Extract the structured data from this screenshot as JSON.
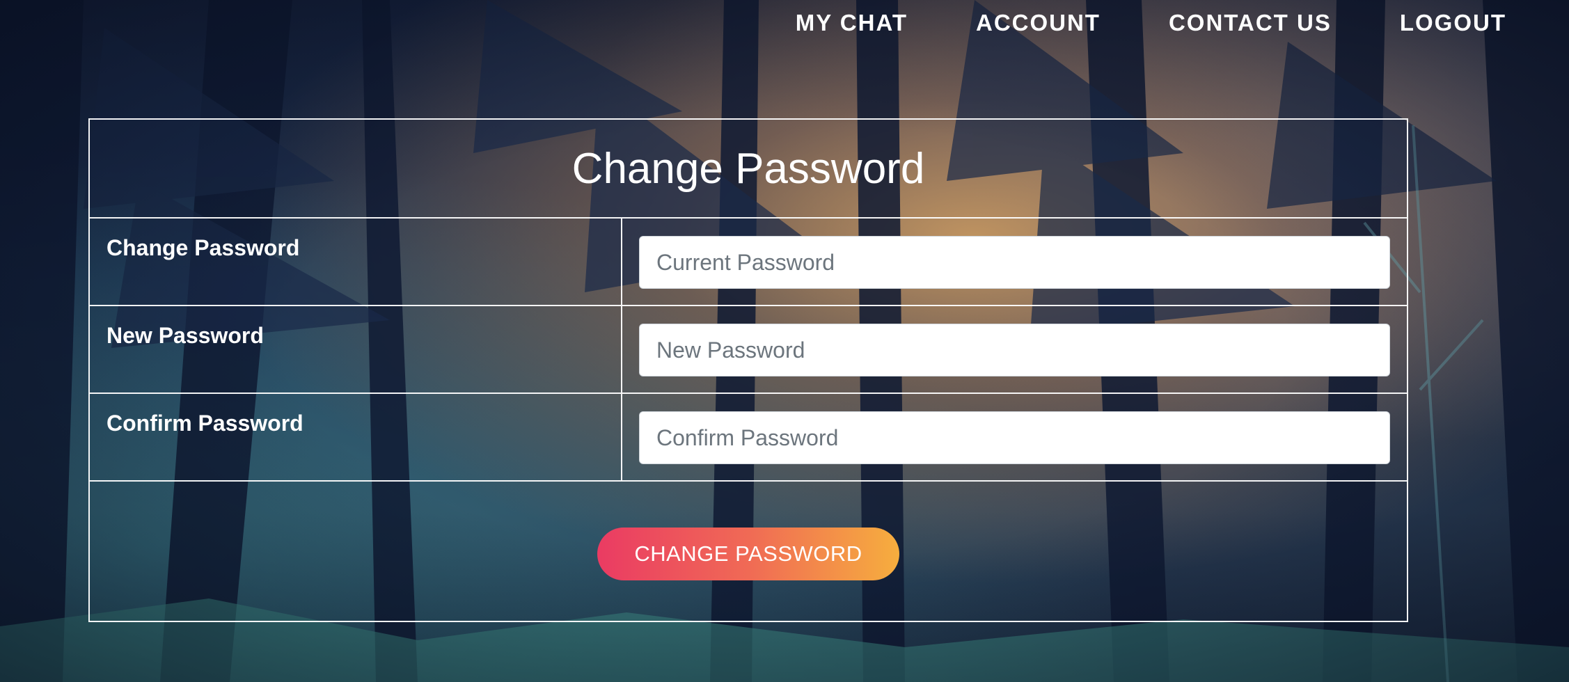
{
  "nav": {
    "items": [
      {
        "label": "MY CHAT"
      },
      {
        "label": "ACCOUNT"
      },
      {
        "label": "CONTACT US"
      },
      {
        "label": "LOGOUT"
      }
    ]
  },
  "form": {
    "title": "Change Password",
    "rows": [
      {
        "label": "Change Password",
        "placeholder": "Current Password",
        "value": ""
      },
      {
        "label": "New Password",
        "placeholder": "New Password",
        "value": ""
      },
      {
        "label": "Confirm Password",
        "placeholder": "Confirm Password",
        "value": ""
      }
    ],
    "submit_label": "CHANGE PASSWORD"
  },
  "colors": {
    "button_gradient_start": "#ea3b63",
    "button_gradient_end": "#f6ae3e",
    "text": "#ffffff",
    "border": "#ffffff"
  }
}
